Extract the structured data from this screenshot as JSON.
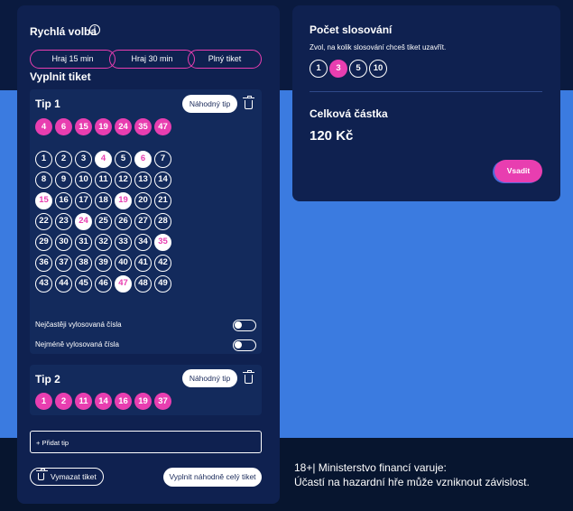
{
  "quick_pick": {
    "title": "Rychlá volba",
    "info_icon": "i",
    "buttons": [
      "Hraj 15 min",
      "Hraj 30 min",
      "Plný tiket"
    ]
  },
  "fill_ticket_title": "Vyplnit tiket",
  "random_tip_label": "Náhodný tip",
  "tips": [
    {
      "title": "Tip 1",
      "selected": [
        "4",
        "6",
        "15",
        "19",
        "24",
        "35",
        "47"
      ],
      "grid": [
        [
          "1",
          "2",
          "3",
          "4",
          "5",
          "6",
          "7"
        ],
        [
          "8",
          "9",
          "10",
          "11",
          "12",
          "13",
          "14"
        ],
        [
          "15",
          "16",
          "17",
          "18",
          "19",
          "20",
          "21"
        ],
        [
          "22",
          "23",
          "24",
          "25",
          "26",
          "27",
          "28"
        ],
        [
          "29",
          "30",
          "31",
          "32",
          "33",
          "34",
          "35"
        ],
        [
          "36",
          "37",
          "38",
          "39",
          "40",
          "41",
          "42"
        ],
        [
          "43",
          "44",
          "45",
          "46",
          "47",
          "48",
          "49"
        ]
      ],
      "toggles": [
        "Nejčastěji vylosovaná čísla",
        "Nejméně vylosovaná čísla"
      ]
    },
    {
      "title": "Tip 2",
      "selected": [
        "1",
        "2",
        "11",
        "14",
        "16",
        "19",
        "37"
      ]
    }
  ],
  "add_tip_label": "+ Přidat tip",
  "clear_ticket_label": "Vymazat tiket",
  "fill_random_label": "Vyplnit náhodně celý tiket",
  "draws": {
    "title": "Počet slosování",
    "subtitle": "Zvol, na kolik slosování chceš tiket uzavřít.",
    "options": [
      "1",
      "3",
      "5",
      "10"
    ],
    "selected": "3"
  },
  "total": {
    "label": "Celková částka",
    "amount": "120 Kč"
  },
  "bet_button_label": "Vsadit",
  "warning": {
    "line1": "18+| Ministerstvo financí varuje:",
    "line2": "Účastí na hazardní hře může vzniknout závislost."
  },
  "colors": {
    "accent": "#e83eb0",
    "panel": "#0f2150",
    "background_band": "#3b7be0"
  }
}
